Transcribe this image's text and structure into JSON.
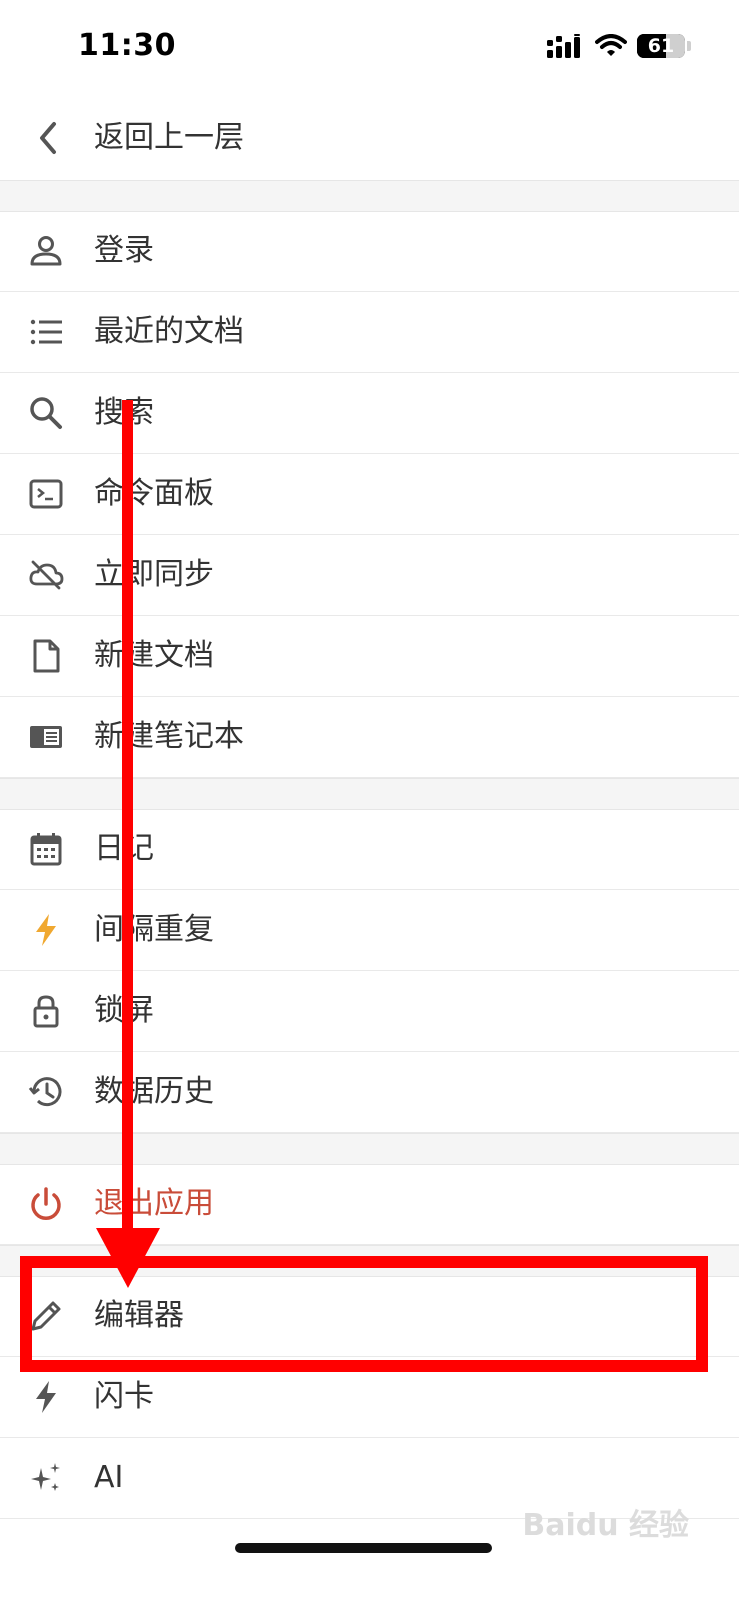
{
  "status_bar": {
    "time": "11:30",
    "battery": "61",
    "battery_level_percent": 61
  },
  "header": {
    "back_label": "返回上一层"
  },
  "menu": {
    "group1": [
      {
        "label": "登录",
        "icon": "user-icon"
      },
      {
        "label": "最近的文档",
        "icon": "list-icon"
      },
      {
        "label": "搜索",
        "icon": "search-icon"
      },
      {
        "label": "命令面板",
        "icon": "terminal-icon"
      },
      {
        "label": "立即同步",
        "icon": "cloud-off-icon"
      },
      {
        "label": "新建文档",
        "icon": "file-icon"
      },
      {
        "label": "新建笔记本",
        "icon": "notebook-icon"
      }
    ],
    "group2": [
      {
        "label": "日记",
        "icon": "calendar-icon"
      },
      {
        "label": "间隔重复",
        "icon": "lightning-icon"
      },
      {
        "label": "锁屏",
        "icon": "lock-icon"
      },
      {
        "label": "数据历史",
        "icon": "history-icon"
      }
    ],
    "group3": [
      {
        "label": "退出应用",
        "icon": "power-icon"
      }
    ],
    "group4": [
      {
        "label": "编辑器",
        "icon": "pencil-icon"
      },
      {
        "label": "闪卡",
        "icon": "flash-icon"
      },
      {
        "label": "AI",
        "icon": "sparkle-icon"
      }
    ]
  },
  "colors": {
    "danger": "#c94c39",
    "accent_bolt": "#f0a830",
    "annotation": "#ff0000"
  },
  "watermark": "Baidu 经验"
}
